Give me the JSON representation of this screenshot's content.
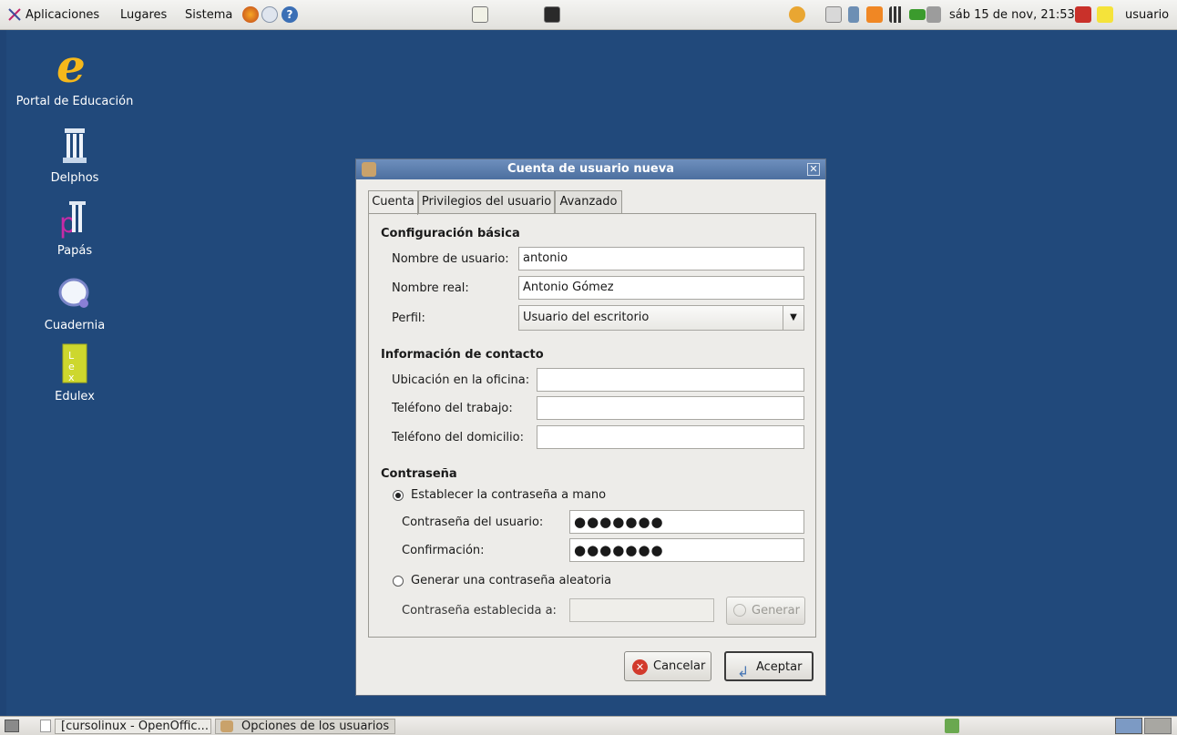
{
  "top_panel": {
    "menus": [
      "Aplicaciones",
      "Lugares",
      "Sistema"
    ],
    "clock": "sáb 15 de nov, 21:53",
    "user": "usuario"
  },
  "desktop_icons": [
    {
      "label": "Portal de Educación",
      "icon": "portal-educacion-icon"
    },
    {
      "label": "Delphos",
      "icon": "delphos-icon"
    },
    {
      "label": "Papás",
      "icon": "papas-icon"
    },
    {
      "label": "Cuadernia",
      "icon": "cuadernia-icon"
    },
    {
      "label": "Edulex",
      "icon": "edulex-icon"
    }
  ],
  "dialog": {
    "title": "Cuenta de usuario nueva",
    "tabs": [
      "Cuenta",
      "Privilegios del usuario",
      "Avanzado"
    ],
    "basic_section": "Configuración básica",
    "username_label": "Nombre de usuario:",
    "username_value": "antonio",
    "realname_label": "Nombre real:",
    "realname_value": "Antonio Gómez",
    "profile_label": "Perfil:",
    "profile_value": "Usuario del escritorio",
    "contact_section": "Información de contacto",
    "office_label": "Ubicación en la oficina:",
    "workphone_label": "Teléfono del trabajo:",
    "homephone_label": "Teléfono del domicilio:",
    "password_section": "Contraseña",
    "manual_radio": "Establecer la contraseña a mano",
    "userpass_label": "Contraseña del usuario:",
    "userpass_value": "●●●●●●●",
    "confirm_label": "Confirmación:",
    "confirm_value": "●●●●●●●",
    "random_radio": "Generar una contraseña aleatoria",
    "random_set_label": "Contraseña establecida a:",
    "generate_button": "Generar",
    "cancel_button": "Cancelar",
    "accept_button": "Aceptar"
  },
  "taskbar": {
    "items": [
      "[cursolinux - OpenOffic...",
      "Opciones de los usuarios"
    ]
  },
  "colors": {
    "desktop": "#21497b",
    "titlebar": "#5b7eae",
    "dialog_bg": "#edece9"
  }
}
